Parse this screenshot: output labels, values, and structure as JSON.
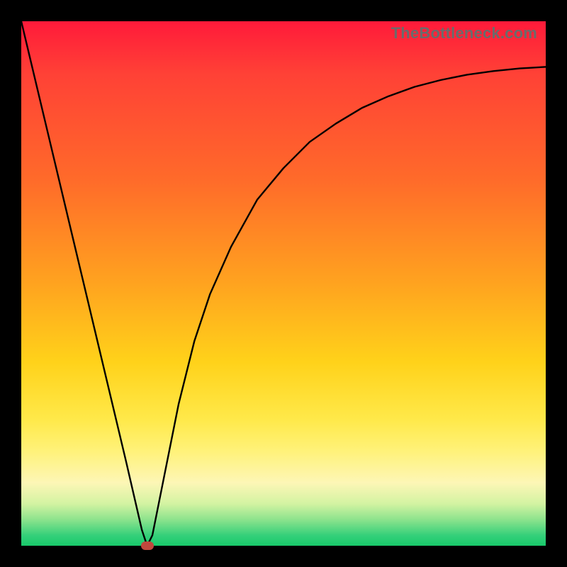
{
  "watermark": "TheBottleneck.com",
  "colors": {
    "frame": "#000000",
    "curve": "#000000",
    "marker": "#c0483d",
    "gradient_top": "#ff1a3a",
    "gradient_bottom": "#18c96b"
  },
  "chart_data": {
    "type": "line",
    "title": "",
    "xlabel": "",
    "ylabel": "",
    "xlim": [
      0,
      100
    ],
    "ylim": [
      0,
      100
    ],
    "grid": false,
    "series": [
      {
        "name": "bottleneck-curve",
        "x": [
          0,
          5,
          10,
          15,
          20,
          23,
          24,
          25,
          27,
          30,
          33,
          36,
          40,
          45,
          50,
          55,
          60,
          65,
          70,
          75,
          80,
          85,
          90,
          95,
          100
        ],
        "values": [
          100,
          79,
          58,
          37,
          16,
          3,
          0,
          2,
          12,
          27,
          39,
          48,
          57,
          66,
          72,
          77,
          80.5,
          83.5,
          85.7,
          87.5,
          88.8,
          89.8,
          90.5,
          91,
          91.3
        ]
      }
    ],
    "marker": {
      "x": 24,
      "y": 0
    }
  }
}
